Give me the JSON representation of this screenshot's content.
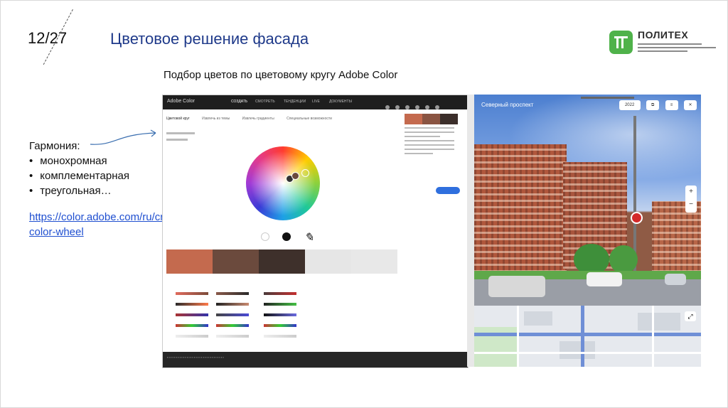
{
  "slide": {
    "number": "12/27",
    "title": "Цветовое решение фасада",
    "subtitle": "Подбор цветов по цветовому кругу Adobe Color"
  },
  "logo": {
    "name": "ПОЛИТЕХ",
    "icon": "polytech-logo-icon",
    "color": "#4fb24a"
  },
  "harmony": {
    "heading": "Гармония:",
    "items": [
      "монохромная",
      "комплементарная",
      "треугольная…"
    ]
  },
  "link": {
    "line1": "https://color.adobe.com/ru/create/",
    "line2": "color-wheel"
  },
  "adobe": {
    "brand": "Adobe Color",
    "nav": [
      "СОЗДАТЬ",
      "СМОТРЕТЬ",
      "ТЕНДЕНЦИИ",
      "LIVE",
      "ДОКУМЕНТЫ"
    ],
    "tabs": [
      "Цветовой круг",
      "Извлечь из темы",
      "Извлечь градиенты",
      "Специальные возможности"
    ],
    "swatches": [
      "#c46a4e",
      "#6b4a3d",
      "#3e302b",
      "#e6e6e6",
      "#e8e8e8"
    ],
    "palette": [
      "#c46a4e",
      "#8a5442",
      "#3b2e2a"
    ],
    "save": "Сохранить",
    "accent": "#2f6fde"
  },
  "street": {
    "title": "Северный проспект",
    "year": "2022",
    "zoom_in": "+",
    "zoom_out": "−"
  }
}
